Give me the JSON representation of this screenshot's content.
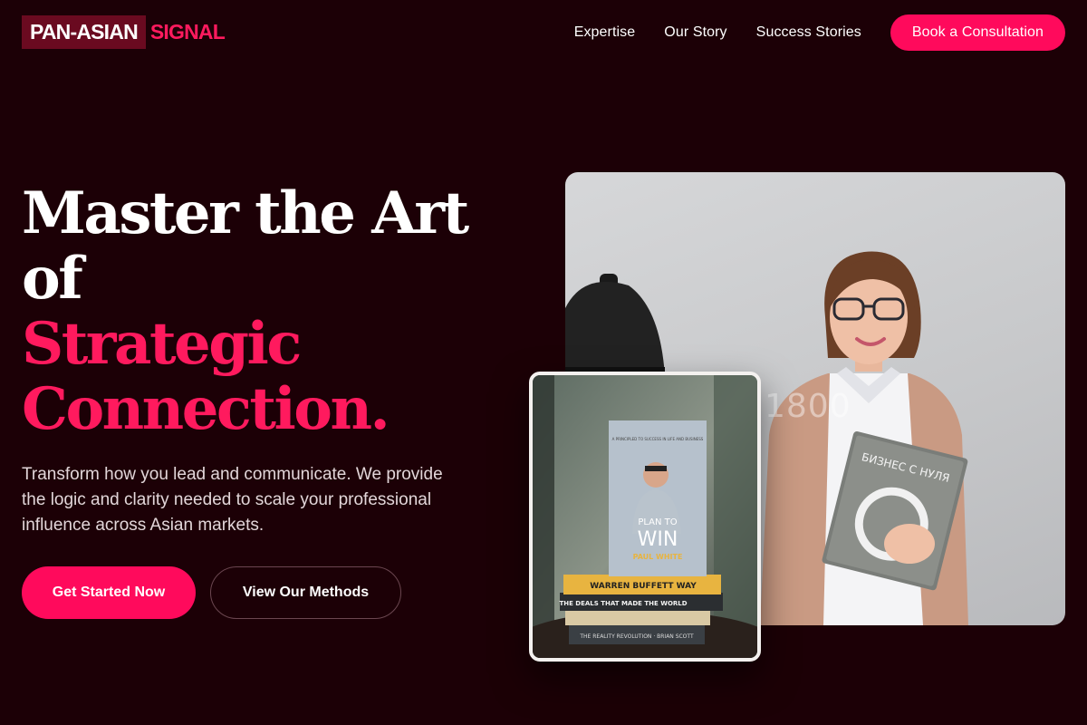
{
  "header": {
    "logo_main": "PAN-ASIAN",
    "logo_accent": "SIGNAL",
    "nav": [
      "Expertise",
      "Our Story",
      "Success Stories"
    ],
    "cta": "Book a Consultation"
  },
  "hero": {
    "title_line1": "Master the Art",
    "title_line2": "of",
    "title_accent1": "Strategic",
    "title_accent2": "Connection.",
    "description": "Transform how you lead and communicate. We provide the logic and clarity needed to scale your professional influence across Asian markets.",
    "primary_button": "Get Started Now",
    "secondary_button": "View Our Methods"
  },
  "photos": {
    "main_watermark": "1800",
    "main_book_title": "БИЗНЕС С НУЛЯ",
    "book_top_tagline": "A PRINCIPLED TO SUCCESS IN LIFE AND BUSINESS",
    "book_top_title1": "PLAN TO",
    "book_top_title2": "WIN",
    "book_top_author": "PAUL WHITE",
    "stack_book1": "WARREN BUFFETT WAY",
    "stack_book2": "THE DEALS THAT MADE THE WORLD",
    "stack_book3": "THE REALITY REVOLUTION · BRIAN SCOTT"
  },
  "colors": {
    "background": "#1c0006",
    "accent": "#ff0a5c",
    "logo_box": "#6a0a20"
  }
}
